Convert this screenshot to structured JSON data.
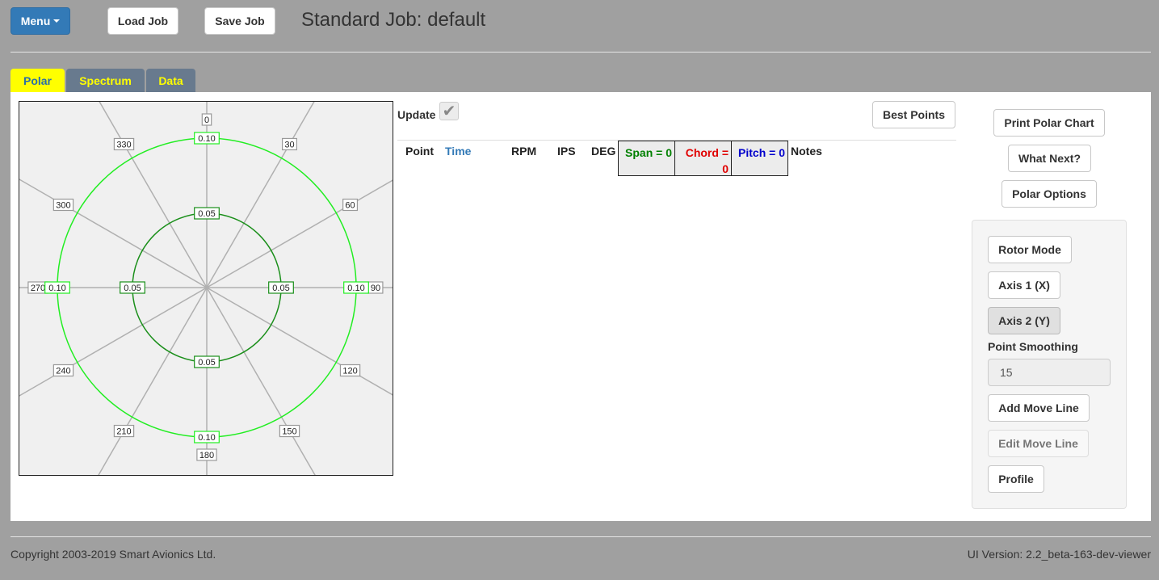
{
  "header": {
    "menu_label": "Menu",
    "load_job_label": "Load Job",
    "save_job_label": "Save Job",
    "job_title": "Standard Job: default"
  },
  "tabs": [
    {
      "label": "Polar",
      "active": true
    },
    {
      "label": "Spectrum",
      "active": false
    },
    {
      "label": "Data",
      "active": false
    }
  ],
  "polar": {
    "angle_labels": [
      "0",
      "30",
      "60",
      "90",
      "120",
      "150",
      "180",
      "210",
      "240",
      "270",
      "300",
      "330"
    ],
    "inner_ring_value": "0.05",
    "outer_ring_value": "0.10",
    "colors": {
      "inner_ring": "#1a8f1a",
      "outer_ring": "#22ee22",
      "limit_ring": "#ffc83a",
      "spokes": "#b0b0b0"
    }
  },
  "controls": {
    "update_label": "Update",
    "update_checked": true,
    "best_points_label": "Best Points"
  },
  "table": {
    "headers": {
      "point": "Point",
      "time": "Time",
      "rpm": "RPM",
      "ips": "IPS",
      "deg": "DEG",
      "span_line1": "Span = 0",
      "chord_line1": "Chord =",
      "chord_line2": "0",
      "pitch_line1": "Pitch = 0",
      "notes": "Notes"
    },
    "colors": {
      "time": "#337ab7",
      "span": "#008000",
      "chord": "#e00000",
      "pitch": "#0000cc"
    },
    "rows": []
  },
  "right_panel": {
    "print_polar_chart_label": "Print Polar Chart",
    "what_next_label": "What Next?",
    "polar_options_label": "Polar Options",
    "rotor_mode_label": "Rotor Mode",
    "axis1_label": "Axis 1 (X)",
    "axis2_label": "Axis 2 (Y)",
    "point_smoothing_label": "Point Smoothing",
    "point_smoothing_value": "15",
    "add_move_line_label": "Add Move Line",
    "edit_move_line_label": "Edit Move Line",
    "profile_label": "Profile"
  },
  "footer": {
    "copyright": "Copyright 2003-2019 Smart Avionics Ltd.",
    "ui_version": "UI Version: 2.2_beta-163-dev-viewer"
  }
}
